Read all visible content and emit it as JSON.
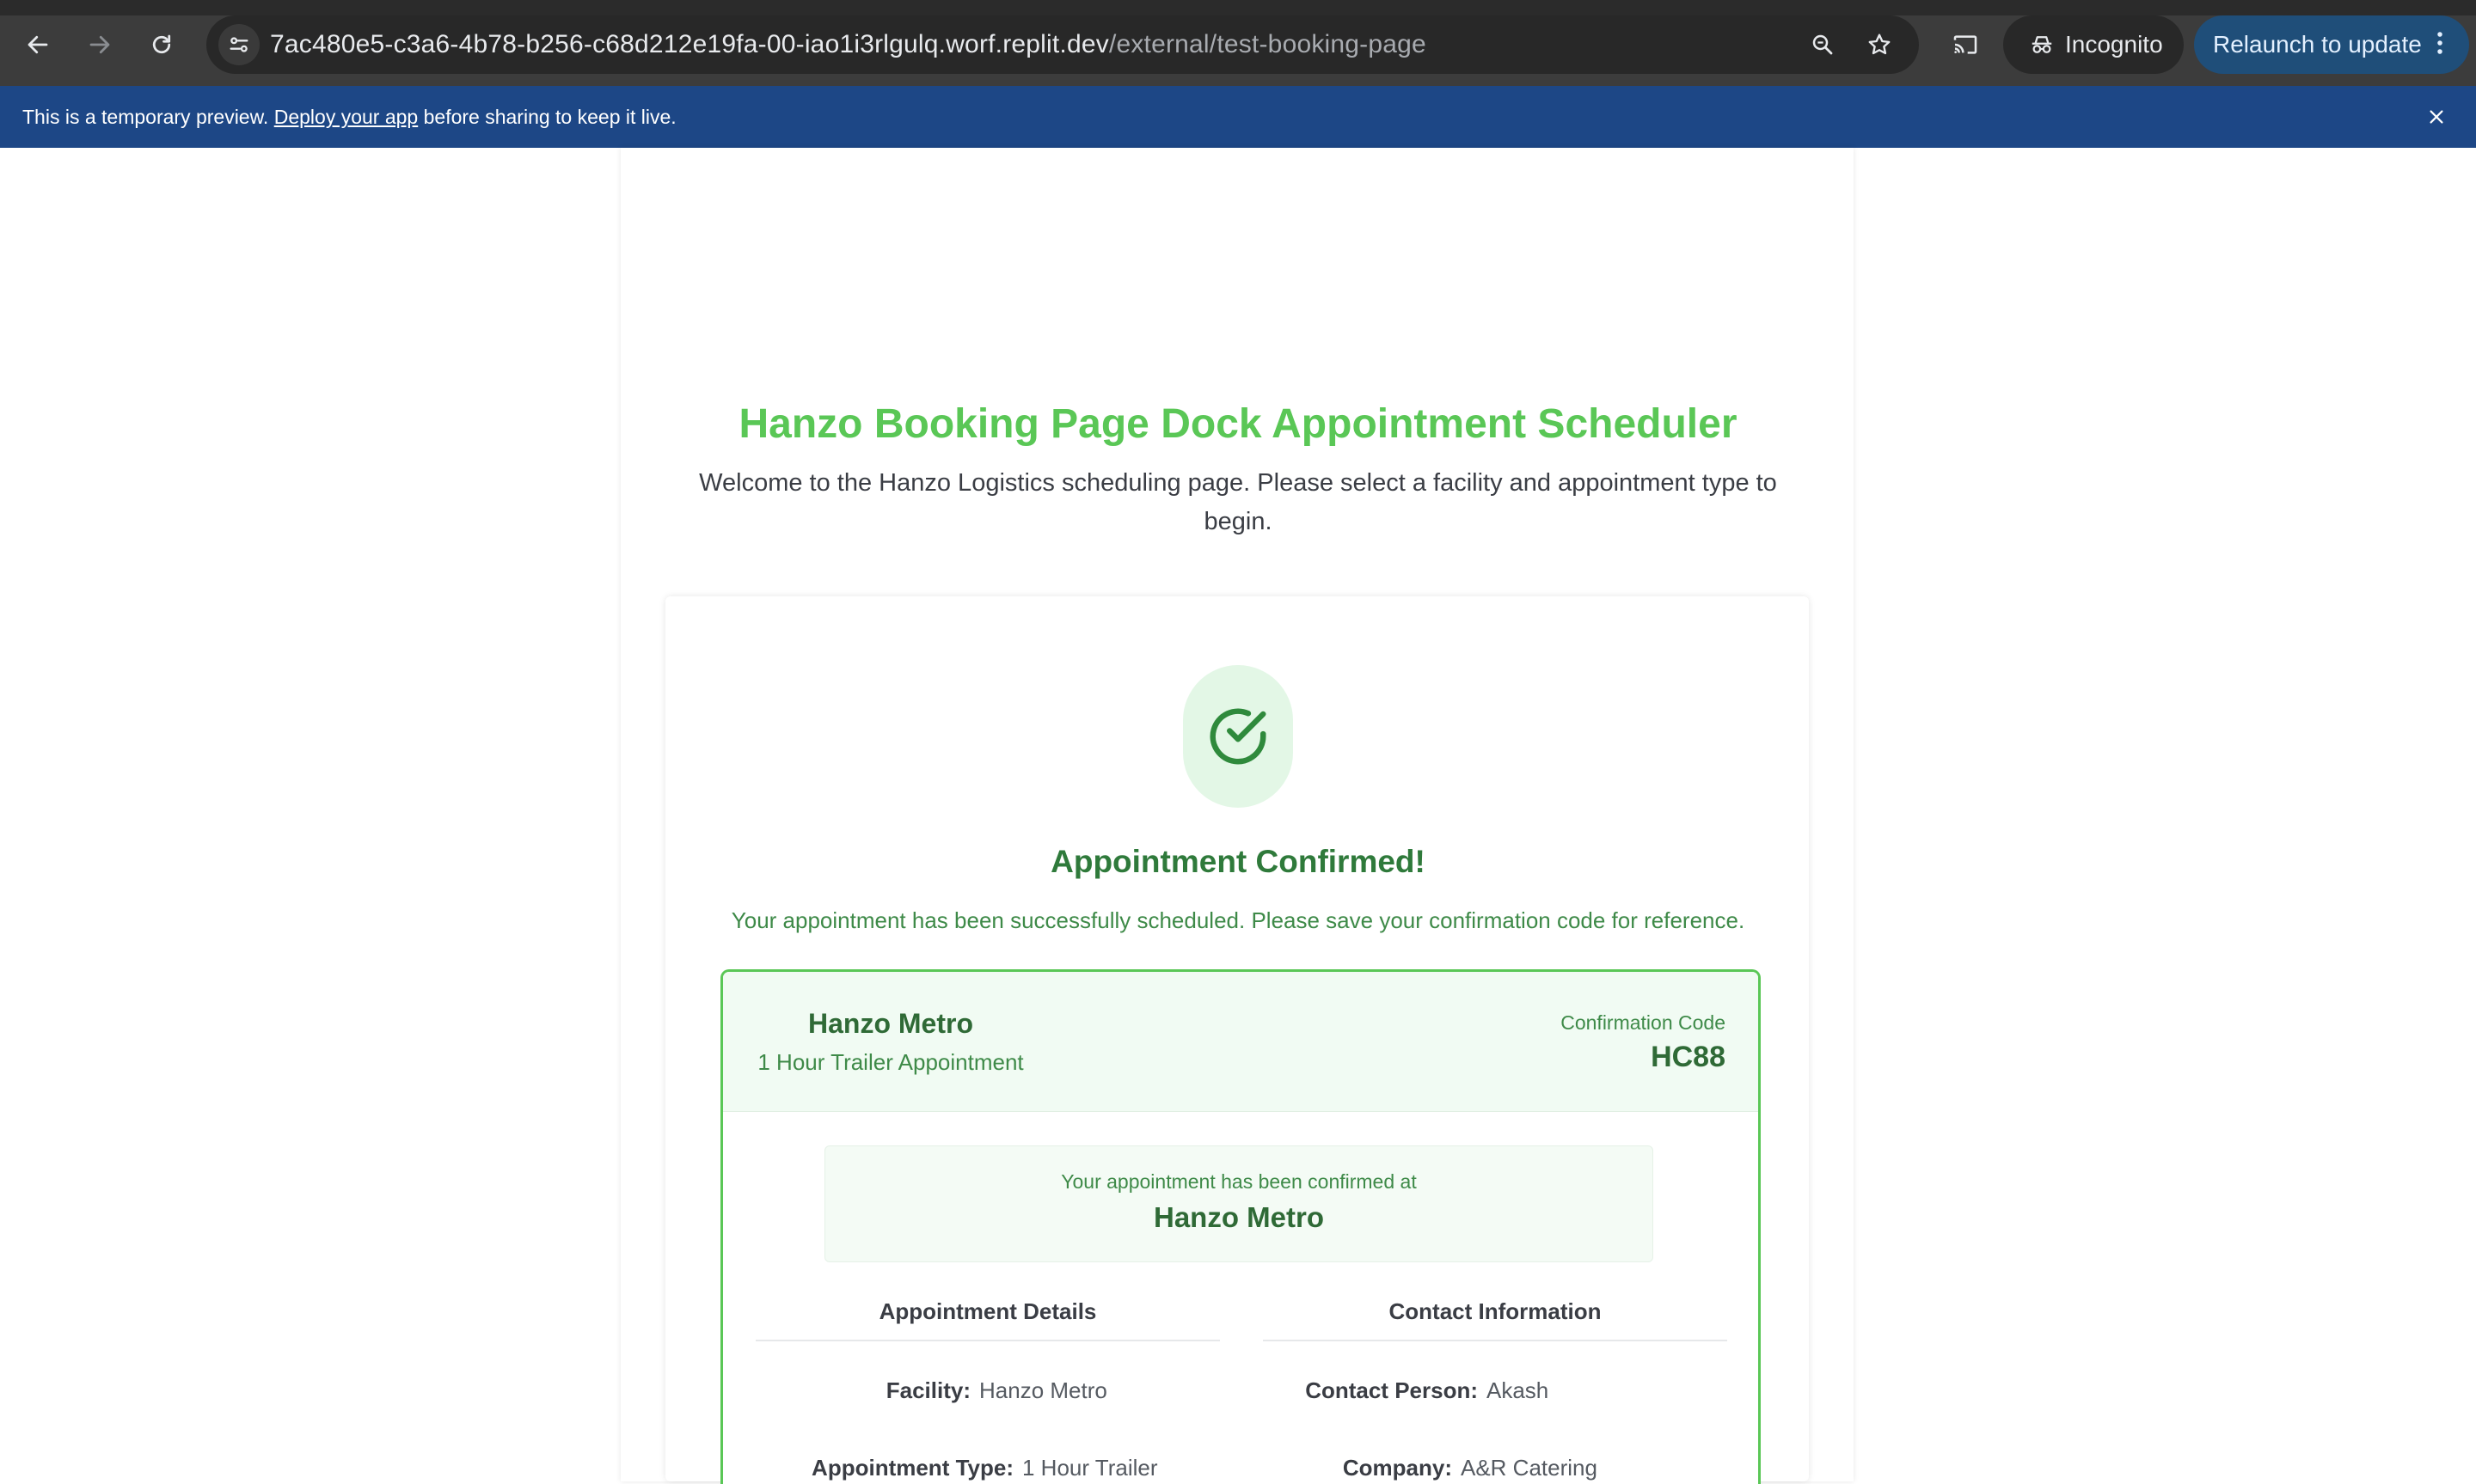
{
  "browser": {
    "url_host": "7ac480e5-c3a6-4b78-b256-c68d212e19fa-00-iao1i3rlgulq.worf.replit.dev",
    "url_path": "/external/test-booking-page",
    "incognito_label": "Incognito",
    "relaunch_label": "Relaunch to update",
    "icons": [
      "back-arrow-icon",
      "forward-arrow-icon",
      "reload-icon",
      "site-info-icon",
      "zoom-icon",
      "star-icon",
      "cast-icon",
      "incognito-icon",
      "more-vert-icon"
    ]
  },
  "banner": {
    "text_before": "This is a temporary preview. ",
    "link_text": "Deploy your app",
    "text_after": " before sharing to keep it live.",
    "color": "#1d4786"
  },
  "page": {
    "title": "Hanzo Booking Page Dock Appointment Scheduler",
    "welcome": "Welcome to the Hanzo Logistics scheduling page. Please select a facility and appointment type to begin.",
    "accent_color": "#5ac756"
  },
  "confirmation": {
    "heading": "Appointment Confirmed!",
    "message": "Your appointment has been successfully scheduled. Please save your confirmation code for reference.",
    "facility_name": "Hanzo Metro",
    "appointment_type": "1 Hour Trailer Appointment",
    "code_label": "Confirmation Code",
    "code": "HC88",
    "confirmed_at_label": "Your appointment has been confirmed at",
    "confirmed_at_value": "Hanzo Metro"
  },
  "details": {
    "appointment_heading": "Appointment Details",
    "contact_heading": "Contact Information",
    "appointment_rows": [
      {
        "key": "Facility:",
        "value": "Hanzo Metro"
      },
      {
        "key": "Appointment Type:",
        "value": "1 Hour Trailer"
      }
    ],
    "contact_rows": [
      {
        "key": "Contact Person:",
        "value": "Akash"
      },
      {
        "key": "Company:",
        "value": "A&R Catering"
      }
    ]
  }
}
